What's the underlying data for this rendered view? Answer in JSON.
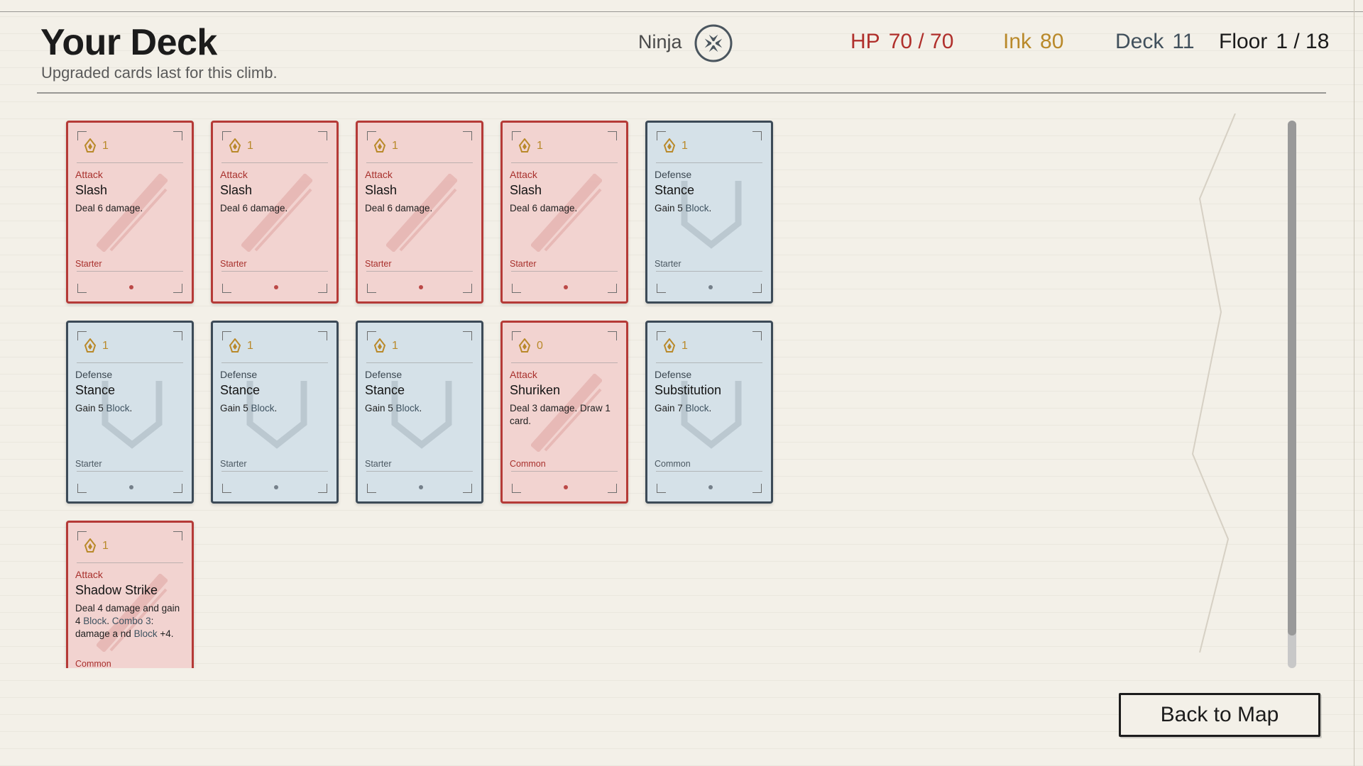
{
  "header": {
    "title": "Your Deck",
    "subtitle": "Upgraded cards last for this climb.",
    "class_name": "Ninja",
    "class_emblem_icon": "shuriken-emblem-icon"
  },
  "stats": {
    "hp_label": "HP",
    "hp_value": "70 / 70",
    "ink_label": "Ink",
    "ink_value": "80",
    "deck_label": "Deck",
    "deck_value": "11",
    "floor_label": "Floor",
    "floor_value": "1 / 18"
  },
  "colors": {
    "attack_border": "#b53a37",
    "attack_fill": "#f2d3d0",
    "defense_border": "#3c4a57",
    "defense_fill": "#d5e1e8",
    "cost_gold": "#b9892a",
    "hp_red": "#b0302c"
  },
  "cards": [
    {
      "kind": "attack",
      "cost": "1",
      "type": "Attack",
      "name": "Slash",
      "desc": "Deal 6 damage.",
      "rarity": "Starter"
    },
    {
      "kind": "attack",
      "cost": "1",
      "type": "Attack",
      "name": "Slash",
      "desc": "Deal 6 damage.",
      "rarity": "Starter"
    },
    {
      "kind": "attack",
      "cost": "1",
      "type": "Attack",
      "name": "Slash",
      "desc": "Deal 6 damage.",
      "rarity": "Starter"
    },
    {
      "kind": "attack",
      "cost": "1",
      "type": "Attack",
      "name": "Slash",
      "desc": "Deal 6 damage.",
      "rarity": "Starter"
    },
    {
      "kind": "defense",
      "cost": "1",
      "type": "Defense",
      "name": "Stance",
      "desc_parts": [
        "Gain 5 ",
        "Block",
        "."
      ],
      "rarity": "Starter"
    },
    {
      "kind": "defense",
      "cost": "1",
      "type": "Defense",
      "name": "Stance",
      "desc_parts": [
        "Gain 5 ",
        "Block",
        "."
      ],
      "rarity": "Starter"
    },
    {
      "kind": "defense",
      "cost": "1",
      "type": "Defense",
      "name": "Stance",
      "desc_parts": [
        "Gain 5 ",
        "Block",
        "."
      ],
      "rarity": "Starter"
    },
    {
      "kind": "defense",
      "cost": "1",
      "type": "Defense",
      "name": "Stance",
      "desc_parts": [
        "Gain 5 ",
        "Block",
        "."
      ],
      "rarity": "Starter"
    },
    {
      "kind": "attack",
      "cost": "0",
      "type": "Attack",
      "name": "Shuriken",
      "desc": "Deal 3 damage. Draw 1 card.",
      "rarity": "Common"
    },
    {
      "kind": "defense",
      "cost": "1",
      "type": "Defense",
      "name": "Substitution",
      "desc_parts": [
        "Gain 7 ",
        "Block",
        "."
      ],
      "rarity": "Common"
    },
    {
      "kind": "attack",
      "cost": "1",
      "type": "Attack",
      "name": "Shadow Strike",
      "desc_parts": [
        "Deal 4 damage and gain 4 ",
        "Block",
        ". ",
        "Combo 3",
        ": damage a nd ",
        "Block",
        " +4."
      ],
      "rarity": "Common"
    }
  ],
  "scrollbar": {
    "thumb_fraction": 0.94
  },
  "footer": {
    "back_label": "Back to Map"
  }
}
